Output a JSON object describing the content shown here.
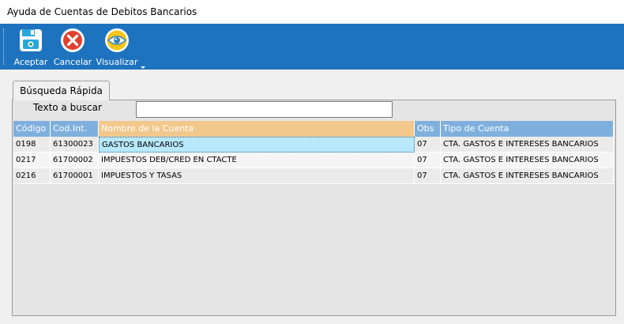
{
  "window": {
    "title": "Ayuda de Cuentas de Debitos Bancarios"
  },
  "toolbar": {
    "buttons": [
      {
        "label": "Aceptar",
        "icon": "save-disk-icon"
      },
      {
        "label": "Cancelar",
        "icon": "cancel-circle-icon"
      },
      {
        "label": "Visualizar",
        "icon": "view-eye-icon"
      }
    ],
    "accent_color": "#1e73be"
  },
  "tab": {
    "label": "Búsqueda Rápida"
  },
  "search": {
    "label": "Texto a buscar",
    "value": "",
    "placeholder": ""
  },
  "grid": {
    "columns": [
      "Código",
      "Cod.Int.",
      "Nombre de la Cuenta",
      "Obs",
      "Tipo de Cuenta"
    ],
    "sorted_column": "Nombre de la Cuenta",
    "rows": [
      {
        "codigo": "0198",
        "cod_int": "61300023",
        "nombre": "GASTOS BANCARIOS",
        "obs": "07",
        "tipo": "CTA. GASTOS E INTERESES BANCARIOS"
      },
      {
        "codigo": "0217",
        "cod_int": "61700002",
        "nombre": "IMPUESTOS DEB/CRED EN CTACTE",
        "obs": "07",
        "tipo": "CTA. GASTOS E INTERESES BANCARIOS"
      },
      {
        "codigo": "0216",
        "cod_int": "61700001",
        "nombre": "IMPUESTOS Y TASAS",
        "obs": "07",
        "tipo": "CTA. GASTOS E INTERESES BANCARIOS"
      }
    ]
  }
}
